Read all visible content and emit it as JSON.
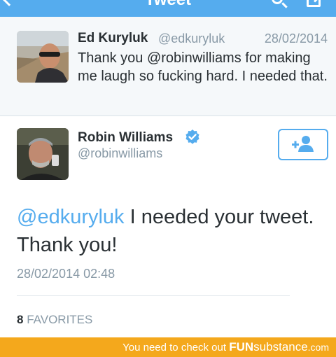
{
  "navbar": {
    "title": "Tweet",
    "background": "#55acee",
    "icons": [
      "back-icon",
      "search-icon",
      "compose-icon"
    ]
  },
  "parent_tweet": {
    "name": "Ed Kuryluk",
    "handle": "@edkuryluk",
    "date": "28/02/2014",
    "text": "Thank you @robinwilliams for making me laugh so fucking hard. I needed that."
  },
  "main_tweet": {
    "name": "Robin Williams",
    "verified": true,
    "handle": "@robinwilliams",
    "follow_icon": "add-user-icon",
    "mention": "@edkuryluk",
    "text": " I needed your tweet. Thank you!",
    "timestamp": "28/02/2014 02:48",
    "favorites_count": "8",
    "favorites_label": "FAVORITES"
  },
  "banner": {
    "prefix": "You need to check out ",
    "brand_fun": "FUN",
    "brand_sub": "substance",
    "brand_tld": ".com",
    "background": "#f4a81c"
  },
  "colors": {
    "accent": "#55acee",
    "muted": "#8899a6",
    "text": "#292f33"
  }
}
